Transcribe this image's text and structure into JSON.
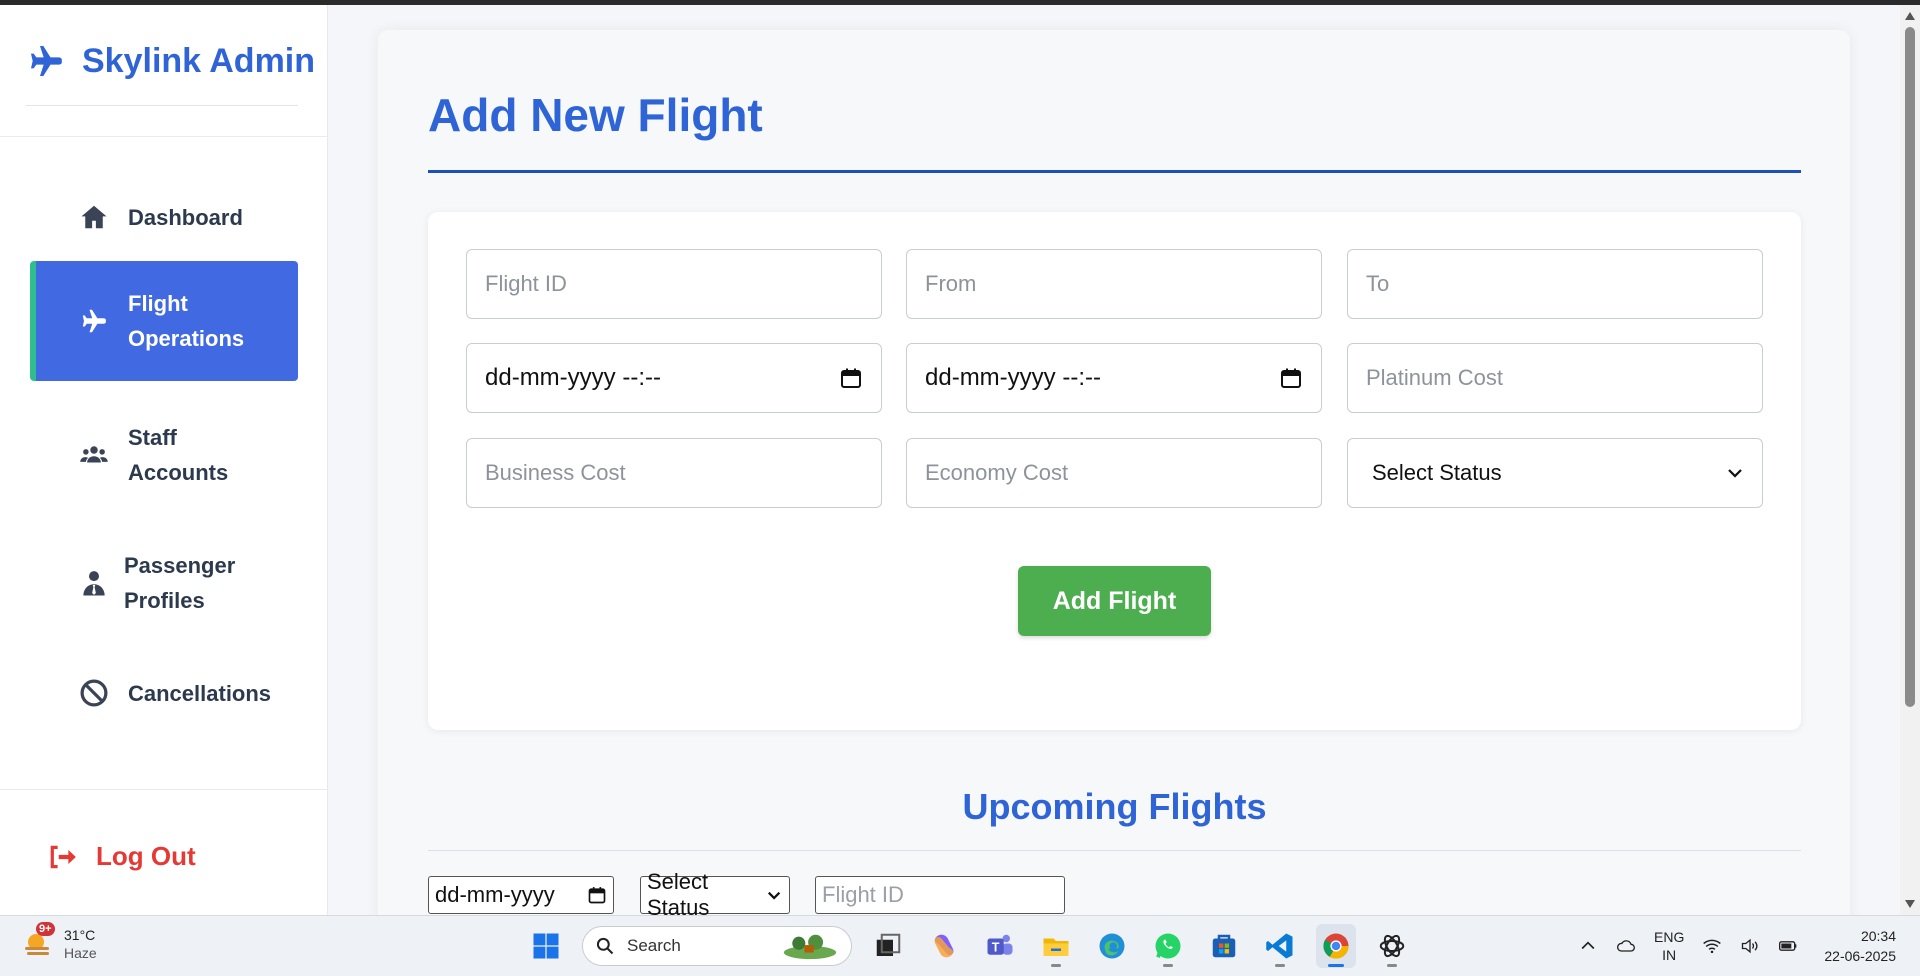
{
  "brand": {
    "name": "Skylink Admin"
  },
  "sidebar": {
    "items": [
      {
        "label": "Dashboard",
        "icon": "home-icon"
      },
      {
        "label": "Flight Operations",
        "icon": "plane-icon",
        "active": true
      },
      {
        "label": "Staff Accounts",
        "icon": "users-icon"
      },
      {
        "label": "Passenger Profiles",
        "icon": "user-tie-icon"
      },
      {
        "label": "Cancellations",
        "icon": "ban-icon"
      }
    ],
    "logout_label": "Log Out"
  },
  "main": {
    "title": "Add New Flight",
    "form": {
      "flight_id_placeholder": "Flight ID",
      "from_placeholder": "From",
      "to_placeholder": "To",
      "departure_value": "dd-mm-yyyy --:--",
      "arrival_value": "dd-mm-yyyy --:--",
      "platinum_placeholder": "Platinum Cost",
      "business_placeholder": "Business Cost",
      "economy_placeholder": "Economy Cost",
      "status_selected": "Select Status",
      "submit_label": "Add Flight"
    },
    "upcoming": {
      "title": "Upcoming Flights",
      "filters": {
        "date_value": "dd-mm-yyyy",
        "status_selected": "Select Status",
        "flight_id_placeholder": "Flight ID"
      }
    }
  },
  "taskbar": {
    "weather": {
      "temp": "31°C",
      "condition": "Haze",
      "badge": "9+"
    },
    "search_label": "Search",
    "language": {
      "line1": "ENG",
      "line2": "IN"
    },
    "time": "20:34",
    "date": "22-06-2025"
  },
  "colors": {
    "accent": "#2f64d6",
    "active_nav": "#4169e1",
    "active_border": "#2fbf8f",
    "add_button": "#4cae4f",
    "logout": "#e53935"
  }
}
